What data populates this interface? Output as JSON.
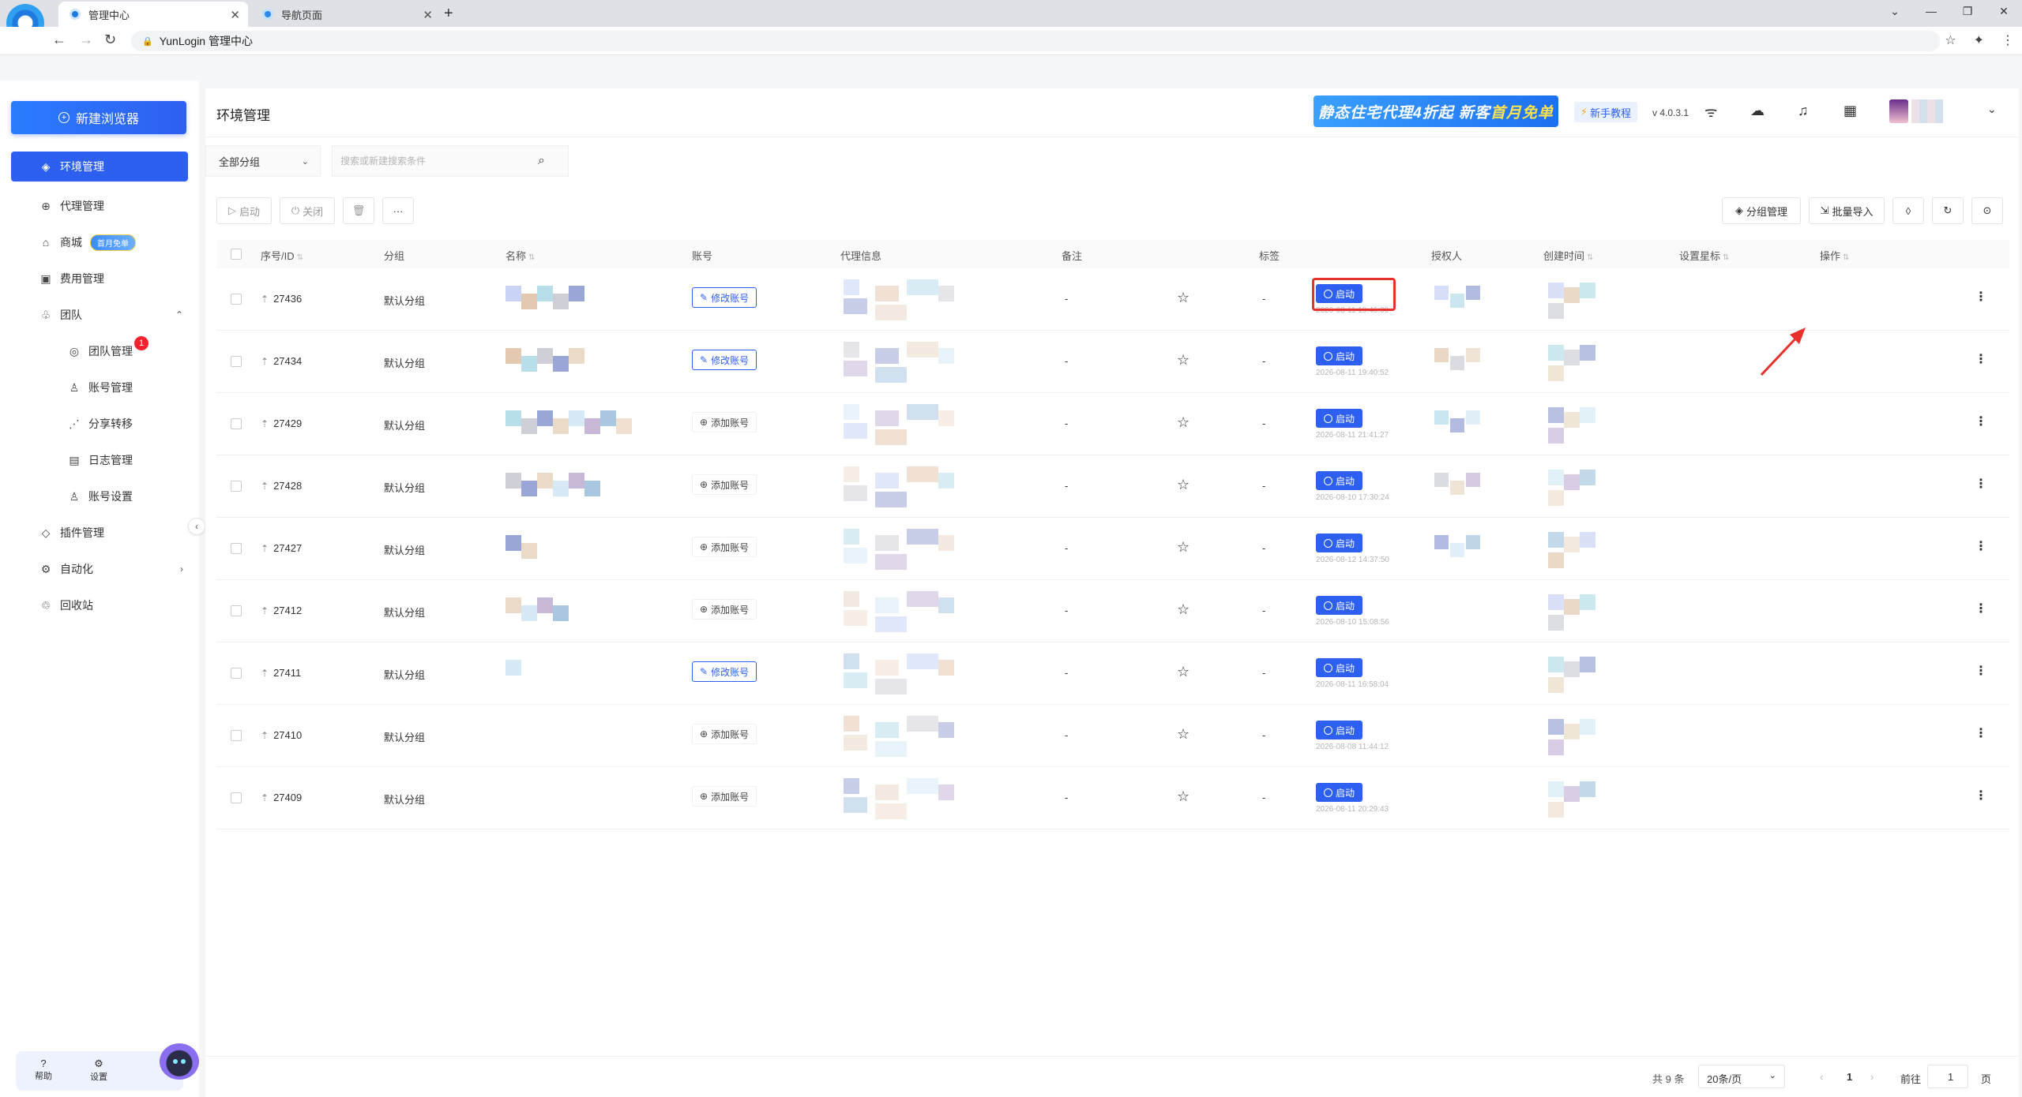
{
  "browser": {
    "tabs": [
      {
        "title": "管理中心"
      },
      {
        "title": "导航页面"
      }
    ],
    "url": "YunLogin 管理中心"
  },
  "sidebar": {
    "new_button": "新建浏览器",
    "items": [
      {
        "label": "环境管理",
        "icon": "cube-icon"
      },
      {
        "label": "代理管理",
        "icon": "globe-icon"
      },
      {
        "label": "商城",
        "icon": "shop-icon",
        "tag": "首月免单"
      },
      {
        "label": "费用管理",
        "icon": "wallet-icon"
      },
      {
        "label": "团队",
        "icon": "team-icon"
      },
      {
        "label": "团队管理",
        "icon": "team-manage-icon",
        "badge": "1"
      },
      {
        "label": "账号管理",
        "icon": "user-icon"
      },
      {
        "label": "分享转移",
        "icon": "share-icon"
      },
      {
        "label": "日志管理",
        "icon": "log-icon"
      },
      {
        "label": "账号设置",
        "icon": "user-settings-icon"
      },
      {
        "label": "插件管理",
        "icon": "plugin-icon"
      },
      {
        "label": "自动化",
        "icon": "automation-icon"
      },
      {
        "label": "回收站",
        "icon": "recycle-icon"
      }
    ],
    "bottom": {
      "help": "帮助",
      "settings": "设置"
    }
  },
  "header": {
    "title": "环境管理",
    "promo_part1": "静态住宅代理4折起 新客",
    "promo_part2": "首月免单",
    "tutorial": "新手教程",
    "version": "v 4.0.3.1"
  },
  "filter": {
    "group": "全部分组",
    "search_placeholder": "搜索或新建搜索条件"
  },
  "toolbar": {
    "start": "启动",
    "close": "关闭",
    "more": "···",
    "group_manage": "分组管理",
    "batch_import": "批量导入"
  },
  "table": {
    "columns": {
      "id": "序号/ID",
      "group": "分组",
      "name": "名称",
      "account": "账号",
      "proxy": "代理信息",
      "remark": "备注",
      "tag": "标签",
      "authorized": "授权人",
      "created": "创建时间",
      "star": "设置星标",
      "action": "操作"
    },
    "start_label": "启动",
    "rows": [
      {
        "id": "27436",
        "group": "默认分组",
        "account": "修改账号",
        "account_type": "edit",
        "remark": "-",
        "tag": "-",
        "time": "2026-08-11 19:46:00"
      },
      {
        "id": "27434",
        "group": "默认分组",
        "account": "修改账号",
        "account_type": "edit",
        "remark": "-",
        "tag": "-",
        "time": "2026-08-11 19:40:52"
      },
      {
        "id": "27429",
        "group": "默认分组",
        "account": "添加账号",
        "account_type": "add",
        "remark": "-",
        "tag": "-",
        "time": "2026-08-11 21:41:27"
      },
      {
        "id": "27428",
        "group": "默认分组",
        "account": "添加账号",
        "account_type": "add",
        "remark": "-",
        "tag": "-",
        "time": "2026-08-10 17:30:24"
      },
      {
        "id": "27427",
        "group": "默认分组",
        "account": "添加账号",
        "account_type": "add",
        "remark": "-",
        "tag": "-",
        "time": "2026-08-12 14:37:50"
      },
      {
        "id": "27412",
        "group": "默认分组",
        "account": "添加账号",
        "account_type": "add",
        "remark": "-",
        "tag": "-",
        "time": "2026-08-10 15:08:56"
      },
      {
        "id": "27411",
        "group": "默认分组",
        "account": "修改账号",
        "account_type": "edit",
        "remark": "-",
        "tag": "-",
        "time": "2026-08-11 16:58:04"
      },
      {
        "id": "27410",
        "group": "默认分组",
        "account": "添加账号",
        "account_type": "add",
        "remark": "-",
        "tag": "-",
        "time": "2026-08-08 11:44:12"
      },
      {
        "id": "27409",
        "group": "默认分组",
        "account": "添加账号",
        "account_type": "add",
        "remark": "-",
        "tag": "-",
        "time": "2026-08-11 20:29:43"
      }
    ]
  },
  "pager": {
    "total": "共 9 条",
    "page_size": "20条/页",
    "current": "1",
    "goto_label": "前往",
    "goto_value": "1",
    "page_suffix": "页"
  },
  "colors": {
    "primary": "#2d5ff0",
    "highlight": "#e8312a"
  }
}
